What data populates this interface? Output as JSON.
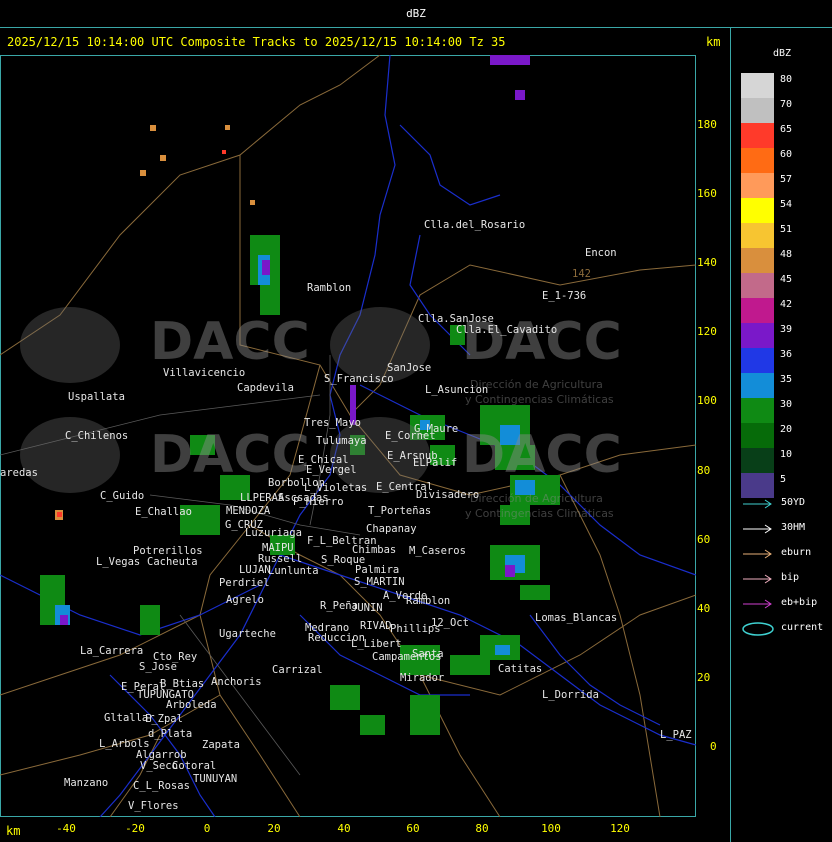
{
  "window": {
    "title": "dBZ"
  },
  "header": {
    "text": "2025/12/15 10:14:00 UTC Composite Tracks to 2025/12/15 10:14:00 Tz 35",
    "km_top": "km",
    "km_bottom": "km"
  },
  "axes": {
    "y_ticks": [
      "180",
      "160",
      "140",
      "120",
      "100",
      "80",
      "60",
      "40",
      "20",
      "0"
    ],
    "x_ticks": [
      "-40",
      "-20",
      "0",
      "20",
      "40",
      "60",
      "80",
      "100",
      "120"
    ]
  },
  "watermark": {
    "logo_text": "DACC",
    "subtitle_1": "Dirección de Agricultura",
    "subtitle_2": "y Contingencias Climáticas"
  },
  "cities": [
    "Clla.del_Rosario",
    "Encon",
    "142",
    "E_1-736",
    "Ramblon",
    "Clla.SanJose",
    "Clla.El_Cavadito",
    "SanJose",
    "Villavicencio",
    "Capdevila",
    "S_Francisco",
    "L_Asuncion",
    "Uspallata",
    "Tres_Mayo",
    "E_Cornet",
    "Tulumaya",
    "C_Chilenos",
    "E_Chical",
    "E_Arsnub",
    "G_Maure",
    "E_Vergel",
    "ELPalif",
    "Borbollon",
    "L_Violetas",
    "E_Central",
    "Divisadero",
    "C_Guido",
    "P_Hierro",
    "LLPERAS",
    "Ascsadas",
    "E_Challao",
    "MENDOZA",
    "G_CRUZ",
    "T_Porteñas",
    "Luzuriaga",
    "Chapanay",
    "F_L_Beltran",
    "Potrerillos",
    "MAIPU",
    "Chimbas",
    "M_Caseros",
    "L_Vegas",
    "Cacheuta",
    "Russell",
    "S_Roque",
    "Palmira",
    "LUJAN",
    "Lunlunta",
    "S_MARTIN",
    "Perdriel",
    "A_Verde",
    "Agrelo",
    "R_Peña",
    "JUNIN",
    "Ramblon",
    "Lomas_Blancas",
    "12_Oct",
    "Medrano",
    "RIVAD",
    "Phillips",
    "Ugarteche",
    "Reduccion",
    "La_Carrera",
    "Cto_Rey",
    "L_Libert",
    "S_Jose",
    "Campamentos",
    "Santa",
    "Carrizal",
    "Catitas",
    "E_Peral",
    "B_Btias",
    "Anchoris",
    "Mirador",
    "TUPUNGATO",
    "L_Dorrida",
    "E_Zpal",
    "Arboleda",
    "Gltallar",
    "d_Plata",
    "L_PAZ",
    "L_Arbols",
    "Zapata",
    "Algarrob",
    "V_Seco",
    "Cotoral",
    "TUNUYAN",
    "Manzano",
    "C_L_Rosas",
    "V_Flores",
    "aredas"
  ],
  "legend": {
    "title": "dBZ",
    "levels": [
      {
        "label": "80",
        "color": "#d6d6d6"
      },
      {
        "label": "70",
        "color": "#c0c0c0"
      },
      {
        "label": "65",
        "color": "#ff3a2a"
      },
      {
        "label": "60",
        "color": "#ff6b14"
      },
      {
        "label": "57",
        "color": "#ff9a5a"
      },
      {
        "label": "54",
        "color": "#ffff00"
      },
      {
        "label": "51",
        "color": "#f7c531"
      },
      {
        "label": "48",
        "color": "#d98f3d"
      },
      {
        "label": "45",
        "color": "#c26a8a"
      },
      {
        "label": "42",
        "color": "#c0198e"
      },
      {
        "label": "39",
        "color": "#7a18c9"
      },
      {
        "label": "36",
        "color": "#2038e6"
      },
      {
        "label": "35",
        "color": "#138dd8"
      },
      {
        "label": "30",
        "color": "#0f8a14"
      },
      {
        "label": "20",
        "color": "#066b09"
      },
      {
        "label": "10",
        "color": "#083f18"
      },
      {
        "label": "5",
        "color": "#4a3a8a"
      }
    ],
    "tracks": [
      {
        "label": "50YD",
        "color": "#3fd1d1"
      },
      {
        "label": "30HM",
        "color": "#ffffff"
      },
      {
        "label": "eburn",
        "color": "#e8b078"
      },
      {
        "label": "bip",
        "color": "#f0b0c0"
      },
      {
        "label": "eb+bip",
        "color": "#d040d0"
      },
      {
        "label": "current",
        "color": "#3fd1d1"
      }
    ]
  }
}
